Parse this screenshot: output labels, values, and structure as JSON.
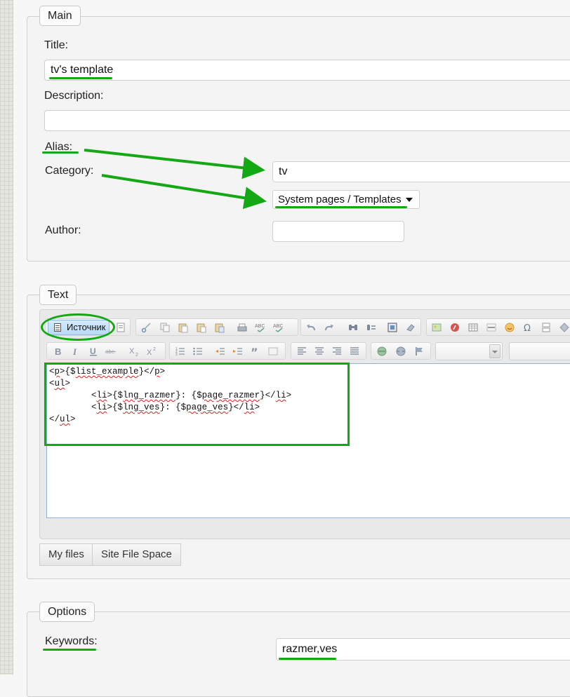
{
  "main": {
    "legend": "Main",
    "title_label": "Title:",
    "title_value": "tv's template",
    "description_label": "Description:",
    "description_value": "",
    "alias_label": "Alias:",
    "alias_value": "tv",
    "category_label": "Category:",
    "category_value": "System pages / Templates",
    "author_label": "Author:",
    "author_value": ""
  },
  "text": {
    "legend": "Text",
    "source_button": "Источник",
    "code_lines": [
      [
        {
          "t": "<"
        },
        {
          "t": "p",
          "sq": true
        },
        {
          "t": ">{$"
        },
        {
          "t": "list_example",
          "sq": true
        },
        {
          "t": "}</"
        },
        {
          "t": "p",
          "sq": true
        },
        {
          "t": ">"
        }
      ],
      [
        {
          "t": "<"
        },
        {
          "t": "ul",
          "sq": true
        },
        {
          "t": ">"
        }
      ],
      [
        {
          "t": "        <"
        },
        {
          "t": "li",
          "sq": true
        },
        {
          "t": ">{$"
        },
        {
          "t": "lng_razmer",
          "sq": true
        },
        {
          "t": "}: {$"
        },
        {
          "t": "page_razmer",
          "sq": true
        },
        {
          "t": "}</"
        },
        {
          "t": "li",
          "sq": true
        },
        {
          "t": ">"
        }
      ],
      [
        {
          "t": "        <"
        },
        {
          "t": "li",
          "sq": true
        },
        {
          "t": ">{$"
        },
        {
          "t": "lng_ves",
          "sq": true
        },
        {
          "t": "}: {$"
        },
        {
          "t": "page_ves",
          "sq": true
        },
        {
          "t": "}</"
        },
        {
          "t": "li",
          "sq": true
        },
        {
          "t": ">"
        }
      ],
      [
        {
          "t": "</"
        },
        {
          "t": "ul",
          "sq": true
        },
        {
          "t": ">"
        }
      ]
    ],
    "tabs": [
      "My files",
      "Site File Space"
    ]
  },
  "options": {
    "legend": "Options",
    "keywords_label": "Keywords:",
    "keywords_value": "razmer,ves"
  },
  "colors": {
    "annotation_green": "#14a814",
    "source_button_bg": "#c6e2f8"
  },
  "icons": {
    "toolbar_row1": [
      "document-icon",
      "cut-icon",
      "copy-icon",
      "paste-icon",
      "paste-text-icon",
      "paste-word-icon",
      "print-icon",
      "spellcheck-icon",
      "scayt-icon",
      "undo-icon",
      "redo-icon",
      "find-icon",
      "replace-icon",
      "select-all-icon",
      "remove-format-icon",
      "image-icon",
      "flash-icon",
      "table-icon",
      "horizontal-rule-icon",
      "smiley-icon",
      "special-char-icon",
      "page-break-icon",
      "iframe-icon"
    ],
    "toolbar_row2": [
      "bold-icon",
      "italic-icon",
      "underline-icon",
      "strike-icon",
      "subscript-icon",
      "superscript-icon",
      "numbered-list-icon",
      "bulleted-list-icon",
      "outdent-icon",
      "indent-icon",
      "blockquote-icon",
      "align-left-icon",
      "align-center-icon",
      "align-right-icon",
      "justify-icon",
      "link-icon",
      "unlink-icon",
      "anchor-icon"
    ]
  }
}
